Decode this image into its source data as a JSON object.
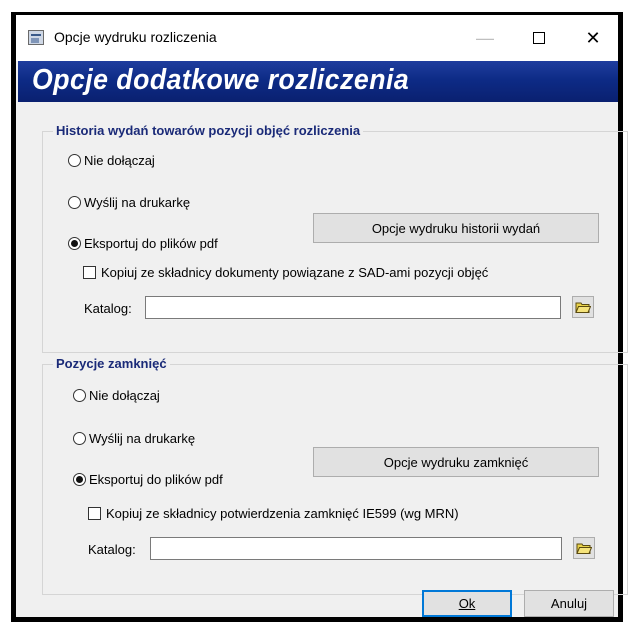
{
  "window": {
    "title": "Opcje wydruku rozliczenia",
    "minimize_glyph": "—",
    "close_glyph": "✕"
  },
  "banner": {
    "text": "Opcje dodatkowe rozliczenia"
  },
  "history_group": {
    "title": "Historia wydań towarów pozycji objęć rozliczenia",
    "options": [
      "Nie dołączaj",
      "Wyślij na drukarkę",
      "Eksportuj do plików pdf"
    ],
    "selected_index": 2,
    "print_options_button": "Opcje wydruku historii wydań",
    "copy_checkbox": {
      "label": "Kopiuj ze składnicy dokumenty powiązane z SAD-ami pozycji objęć",
      "checked": false
    },
    "catalog_label": "Katalog:",
    "catalog_value": ""
  },
  "closures_group": {
    "title": "Pozycje zamknięć",
    "options": [
      "Nie dołączaj",
      "Wyślij na drukarkę",
      "Eksportuj do plików pdf"
    ],
    "selected_index": 2,
    "print_options_button": "Opcje wydruku zamknięć",
    "copy_checkbox": {
      "label": "Kopiuj ze składnicy potwierdzenia zamknięć IE599 (wg MRN)",
      "checked": false
    },
    "catalog_label": "Katalog:",
    "catalog_value": ""
  },
  "footer": {
    "ok_label": "Ok",
    "cancel_label": "Anuluj"
  },
  "colors": {
    "banner": "#0d2b86",
    "group_title": "#1a2a78",
    "folder_icon": "#e8d24a"
  },
  "icons": [
    "app-icon",
    "minimize-icon",
    "maximize-icon",
    "close-icon",
    "folder-icon"
  ]
}
